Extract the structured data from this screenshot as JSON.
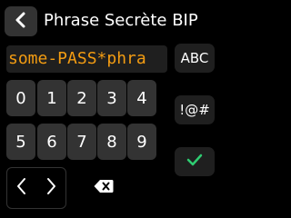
{
  "header": {
    "title": "Phrase Secrète BIP",
    "back_icon": "chevron-left-icon"
  },
  "passphrase": {
    "value": "some-PASS*phra",
    "color": "#f39c12"
  },
  "keypad": {
    "keys": [
      "0",
      "1",
      "2",
      "3",
      "4",
      "5",
      "6",
      "7",
      "8",
      "9"
    ]
  },
  "actions": {
    "prev_icon": "chevron-left-icon",
    "next_icon": "chevron-right-icon",
    "delete_icon": "backspace-icon"
  },
  "modes": {
    "letters_label": "ABC",
    "symbols_label": "!@#",
    "confirm_icon": "checkmark-icon",
    "confirm_color": "#2ecc71"
  }
}
